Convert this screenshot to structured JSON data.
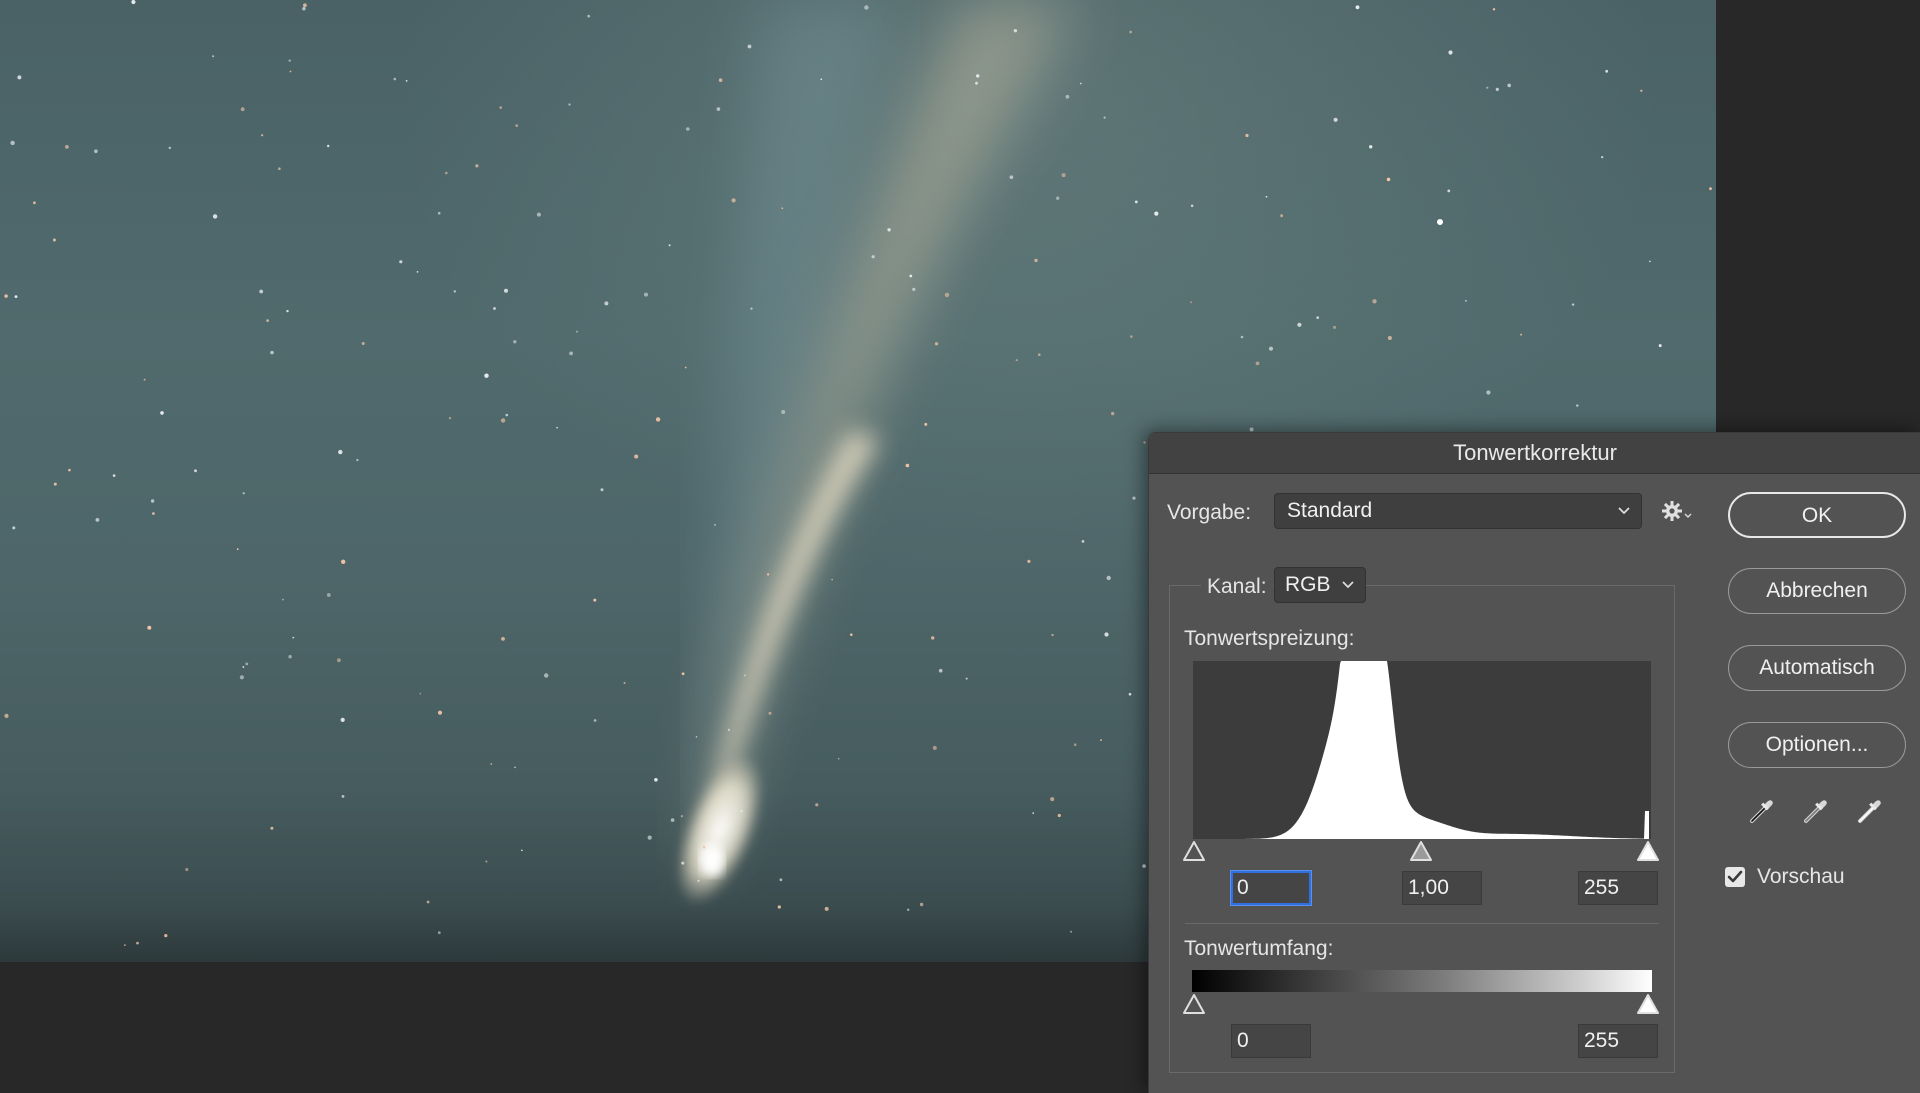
{
  "dialog": {
    "title": "Tonwertkorrektur",
    "preset_label": "Vorgabe:",
    "preset_value": "Standard",
    "channel_label": "Kanal:",
    "channel_value": "RGB",
    "input_levels_label": "Tonwertspreizung:",
    "input_black": "0",
    "input_gamma": "1,00",
    "input_white": "255",
    "output_levels_label": "Tonwertumfang:",
    "output_black": "0",
    "output_white": "255",
    "buttons": {
      "ok": "OK",
      "cancel": "Abbrechen",
      "auto": "Automatisch",
      "options": "Optionen..."
    },
    "preview_label": "Vorschau",
    "preview_checked": true
  },
  "icons": {
    "gear": "gear-icon",
    "chevron": "chevron-down-icon",
    "checkmark": "✓",
    "eyedroppers": [
      "black-point-eyedropper-icon",
      "gray-point-eyedropper-icon",
      "white-point-eyedropper-icon"
    ]
  },
  "colors": {
    "dialog_bg": "#535353",
    "focus_ring": "#2f6fe0",
    "histogram_fill": "#ffffff",
    "sky": "#4e6669"
  }
}
